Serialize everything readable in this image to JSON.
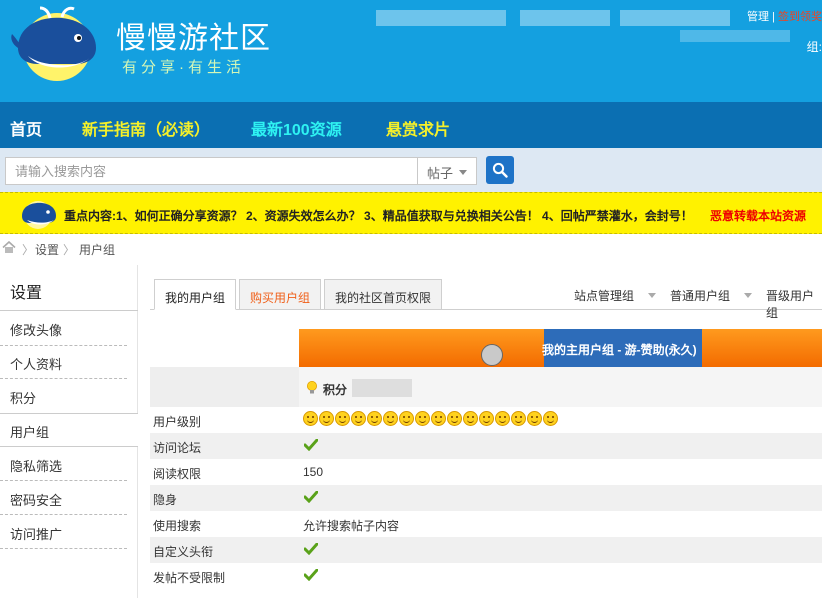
{
  "header": {
    "site_name": "慢慢游社区",
    "slogan": "有分享·有生活",
    "top_link_manage": "管理",
    "top_link_sep": "|",
    "top_link_red": "签到领奖",
    "group_label": "组:"
  },
  "nav": {
    "home": "首页",
    "guide": "新手指南（必读）",
    "latest": "最新100资源",
    "bounty": "悬赏求片"
  },
  "search": {
    "placeholder": "请输入搜索内容",
    "type": "帖子",
    "button_icon": "search-icon"
  },
  "notice": {
    "text": "重点内容:1、如何正确分享资源？   2、资源失效怎么办？   3、精品值获取与兑换相关公告！   4、回帖严禁灌水，会封号！",
    "red_text": "恶意转载本站资源"
  },
  "breadcrumb": {
    "sep": "〉",
    "items": [
      "设置",
      "用户组"
    ]
  },
  "sidebar": {
    "title": "设置",
    "items": [
      "修改头像",
      "个人资料",
      "积分",
      "用户组",
      "隐私筛选",
      "密码安全",
      "访问推广"
    ]
  },
  "tabs": [
    {
      "label": "我的用户组"
    },
    {
      "label": "购买用户组"
    },
    {
      "label": "我的社区首页权限"
    }
  ],
  "right_menu": [
    "站点管理组",
    "普通用户组",
    "晋级用户组"
  ],
  "group_banner": "我的主用户组 - 游-赞助(永久)",
  "score_label": "积分",
  "permissions": [
    {
      "label": "用户级别",
      "type": "faces",
      "count": 16
    },
    {
      "label": "访问论坛",
      "type": "check"
    },
    {
      "label": "阅读权限",
      "type": "text",
      "value": "150"
    },
    {
      "label": "隐身",
      "type": "check"
    },
    {
      "label": "使用搜索",
      "type": "text",
      "value": "允许搜索帖子内容"
    },
    {
      "label": "自定义头衔",
      "type": "check"
    },
    {
      "label": "发帖不受限制",
      "type": "check"
    }
  ],
  "colors": {
    "header_bg": "#14a0e0",
    "nav_bg": "#0b6fb2",
    "notice_bg": "#fff200",
    "banner_orange": "#f36b00",
    "banner_blue": "#2d6cb9",
    "check_green": "#5aa21a"
  }
}
